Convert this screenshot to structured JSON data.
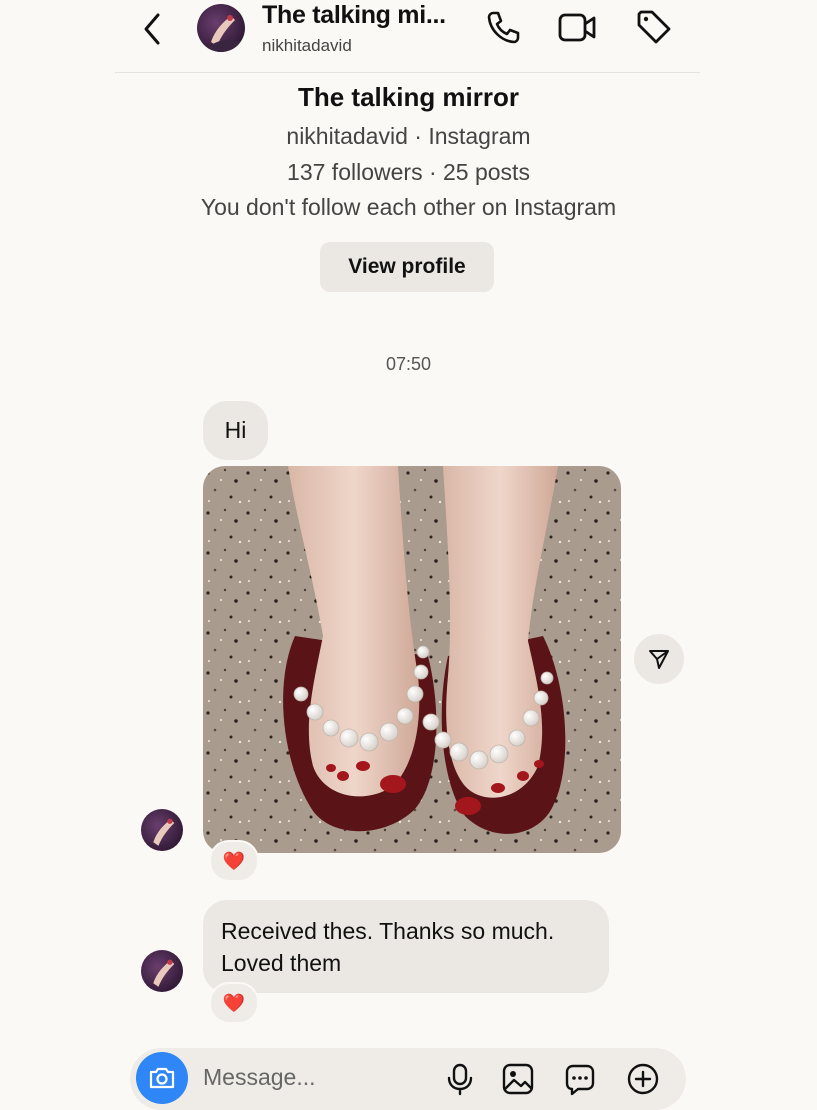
{
  "header": {
    "title": "The talking mi...",
    "username": "nikhitadavid",
    "icons": [
      "back-arrow-icon",
      "phone-icon",
      "video-call-icon",
      "tag-icon"
    ]
  },
  "profile": {
    "name": "The talking mirror",
    "source": "nikhitadavid · Instagram",
    "stats": "137 followers · 25 posts",
    "relationship": "You don't follow each other on Instagram",
    "view_profile_label": "View profile"
  },
  "timestamp": "07:50",
  "messages": {
    "hi": "Hi",
    "photo_reaction": "❤️",
    "text_line1": "Received thes. Thanks so much.",
    "text_line2": "Loved them",
    "text_reaction": "❤️"
  },
  "composer": {
    "placeholder": "Message...",
    "icons": [
      "camera-icon",
      "microphone-icon",
      "gallery-icon",
      "sticker-icon",
      "plus-icon"
    ]
  },
  "colors": {
    "background": "#fbf9f6",
    "bubble": "#ebe8e4",
    "camera_button": "#2f86f6",
    "heart": "#e0302b"
  }
}
